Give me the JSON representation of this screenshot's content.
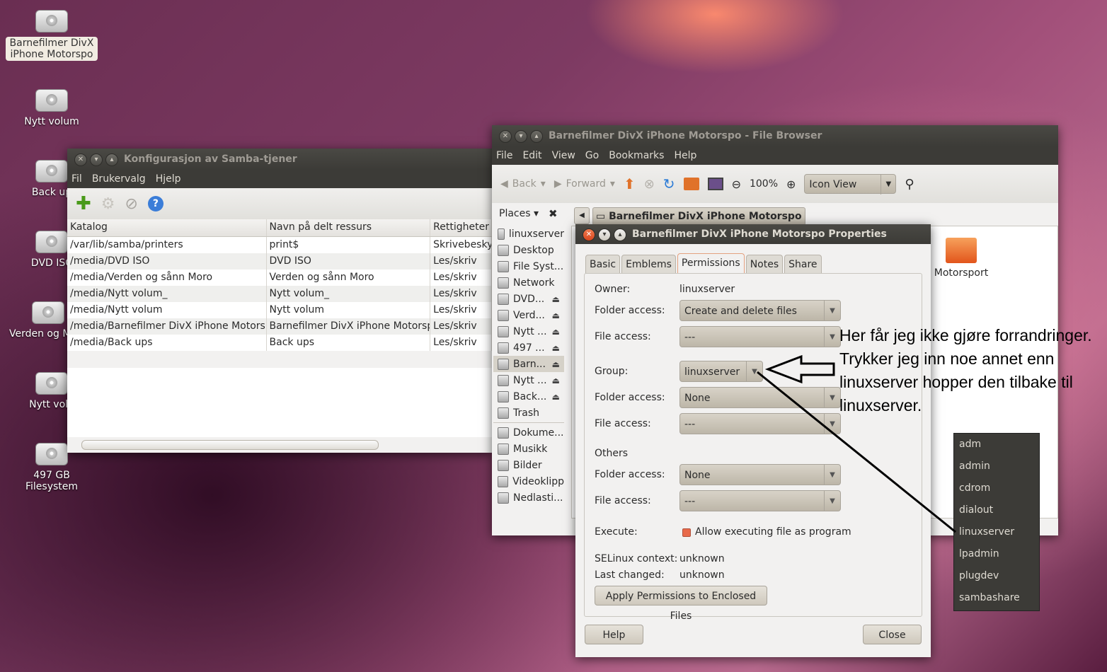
{
  "desktop": {
    "icons": [
      {
        "label": "Barnefilmer DivX iPhone Motorspo",
        "selected": true
      },
      {
        "label": "Nytt volum"
      },
      {
        "label": "Back up"
      },
      {
        "label": "DVD ISC"
      },
      {
        "label": "Verden og Moro"
      },
      {
        "label": "Nytt volu"
      },
      {
        "label": "497 GB Filesystem"
      }
    ]
  },
  "samba": {
    "title": "Konfigurasjon av Samba-tjener",
    "menu": [
      "Fil",
      "Brukervalg",
      "Hjelp"
    ],
    "columns": [
      "Katalog",
      "Navn på delt ressurs",
      "Rettigheter"
    ],
    "rows": [
      [
        "/var/lib/samba/printers",
        "print$",
        "Skrivebeskytt"
      ],
      [
        "/media/DVD ISO",
        "DVD ISO",
        "Les/skriv"
      ],
      [
        "/media/Verden og sånn Moro",
        "Verden og sånn Moro",
        "Les/skriv"
      ],
      [
        "/media/Nytt volum_",
        "Nytt volum_",
        "Les/skriv"
      ],
      [
        "/media/Nytt volum",
        "Nytt volum",
        "Les/skriv"
      ],
      [
        "/media/Barnefilmer DivX iPhone Motorspo",
        "Barnefilmer DivX iPhone Motorspo",
        "Les/skriv"
      ],
      [
        "/media/Back ups",
        "Back ups",
        "Les/skriv"
      ]
    ]
  },
  "browser": {
    "title": "Barnefilmer DivX iPhone Motorspo - File Browser",
    "menu": [
      "File",
      "Edit",
      "View",
      "Go",
      "Bookmarks",
      "Help"
    ],
    "back": "Back",
    "forward": "Forward",
    "zoom": "100%",
    "view_mode": "Icon View",
    "places": "Places",
    "path": "Barnefilmer DivX iPhone Motorspo",
    "folder": "Motorsport",
    "sidebar": [
      {
        "label": "linuxserver"
      },
      {
        "label": "Desktop"
      },
      {
        "label": "File Syst..."
      },
      {
        "label": "Network"
      },
      {
        "label": "DVD...",
        "eject": true
      },
      {
        "label": "Verd...",
        "eject": true
      },
      {
        "label": "Nytt ...",
        "eject": true
      },
      {
        "label": "497 ...",
        "eject": true
      },
      {
        "label": "Barn...",
        "eject": true,
        "selected": true
      },
      {
        "label": "Nytt ...",
        "eject": true
      },
      {
        "label": "Back...",
        "eject": true
      },
      {
        "label": "Trash"
      },
      {
        "label": "Dokume..."
      },
      {
        "label": "Musikk"
      },
      {
        "label": "Bilder"
      },
      {
        "label": "Videoklipp"
      },
      {
        "label": "Nedlasti..."
      }
    ]
  },
  "props": {
    "title": "Barnefilmer DivX iPhone Motorspo Properties",
    "tabs": [
      "Basic",
      "Emblems",
      "Permissions",
      "Notes",
      "Share"
    ],
    "owner_label": "Owner:",
    "owner": "linuxserver",
    "folder_access_label": "Folder access:",
    "file_access_label": "File access:",
    "owner_folder_access": "Create and delete files",
    "owner_file_access": "---",
    "group_label": "Group:",
    "group": "linuxserver",
    "group_folder_access": "None",
    "group_file_access": "---",
    "others_label": "Others",
    "others_folder_access": "None",
    "others_file_access": "---",
    "execute_label": "Execute:",
    "execute_text": "Allow executing file as program",
    "selinux_label": "SELinux context:",
    "selinux": "unknown",
    "changed_label": "Last changed:",
    "changed": "unknown",
    "apply_button": "Apply Permissions to Enclosed Files",
    "help_button": "Help",
    "close_button": "Close"
  },
  "group_popup": [
    "adm",
    "admin",
    "cdrom",
    "dialout",
    "linuxserver",
    "lpadmin",
    "plugdev",
    "sambashare"
  ],
  "annotation": "Her får jeg ikke gjøre forrandringer. Trykker jeg inn noe annet enn linuxserver hopper den tilbake til linuxserver."
}
